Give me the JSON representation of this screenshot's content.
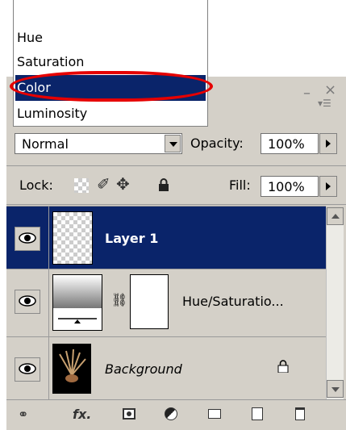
{
  "blend_menu": {
    "items": [
      "Hue",
      "Saturation",
      "Color",
      "Luminosity"
    ],
    "selected": "Color"
  },
  "panel": {
    "blend_mode": "Normal",
    "opacity_label": "Opacity:",
    "opacity_value": "100%",
    "lock_label": "Lock:",
    "fill_label": "Fill:",
    "fill_value": "100%"
  },
  "layers": [
    {
      "name": "Layer 1",
      "selected": true,
      "type": "layer"
    },
    {
      "name": "Hue/Saturatio...",
      "selected": false,
      "type": "adjustment"
    },
    {
      "name": "Background",
      "selected": false,
      "type": "background",
      "locked": true
    }
  ],
  "bottom_bar": {
    "icons": [
      "link-layers-icon",
      "fx-icon",
      "layer-mask-icon",
      "adjustment-layer-icon",
      "new-group-icon",
      "new-layer-icon",
      "trash-icon"
    ],
    "fx_text": "fx."
  },
  "colors": {
    "selection": "#0a246a",
    "panel_bg": "#d4d0c8",
    "highlight_ring": "#e60000"
  }
}
